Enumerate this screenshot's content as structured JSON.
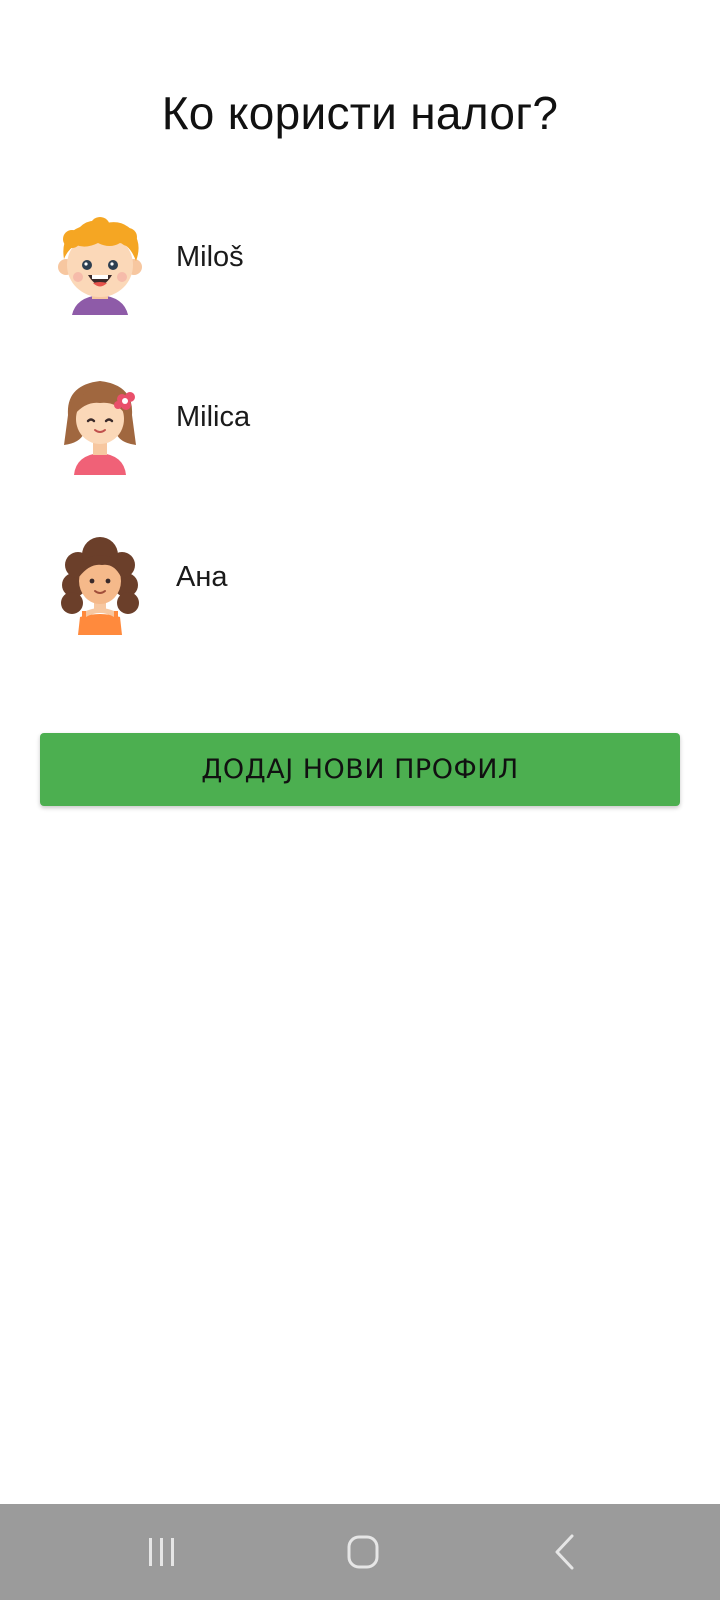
{
  "screen": {
    "title": "Ко користи налог?"
  },
  "profiles": [
    {
      "name": "Miloš",
      "avatar_icon": "boy-avatar-icon"
    },
    {
      "name": "Milica",
      "avatar_icon": "girl-flower-avatar-icon"
    },
    {
      "name": "Ана",
      "avatar_icon": "girl-curly-avatar-icon"
    }
  ],
  "add_profile_button": {
    "label": "ДОДАЈ НОВИ ПРОФИЛ",
    "color": "#4caf50"
  },
  "nav_bar": {
    "background": "#9b9b9b",
    "buttons": [
      "recent-apps-icon",
      "home-icon",
      "back-icon"
    ]
  }
}
